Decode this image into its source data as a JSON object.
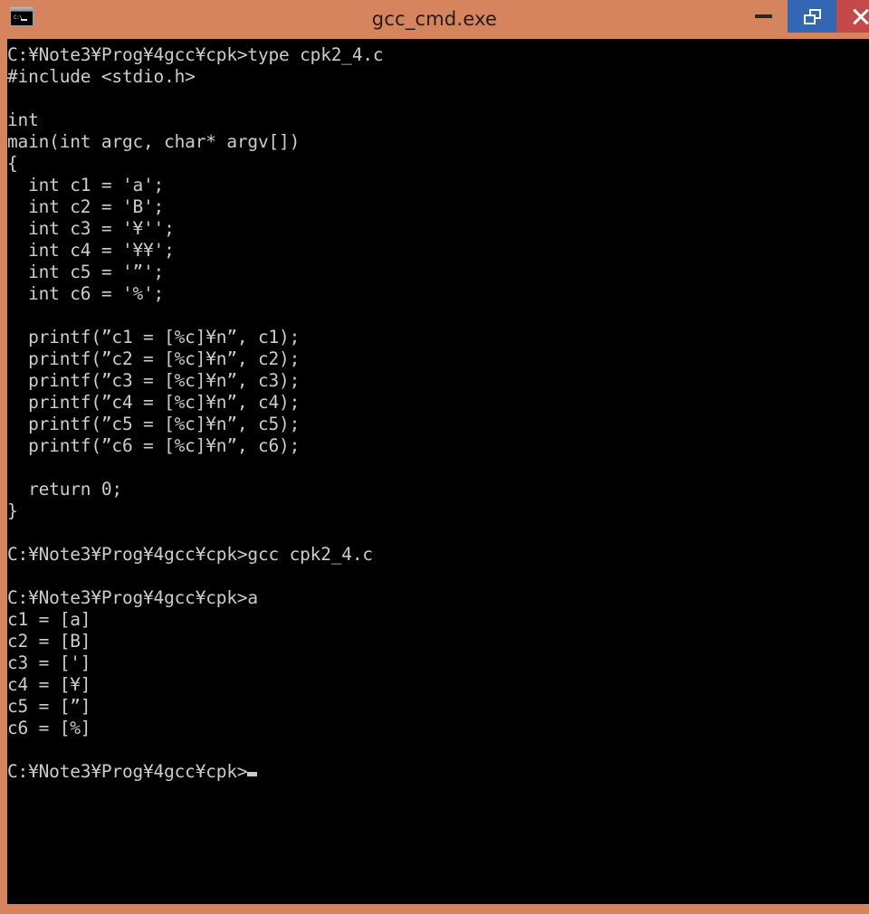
{
  "window": {
    "title": "gcc_cmd.exe",
    "icon": "console-window-icon",
    "icon_prompt_text": "C:\\",
    "frame_color": "#d6845d",
    "console_bg": "#000000",
    "console_fg": "#cccccc"
  },
  "caption_buttons": {
    "minimize": {
      "label": "Minimize",
      "icon": "minimize-icon"
    },
    "restore": {
      "label": "Restore",
      "icon": "restore-icon",
      "highlight_color": "#3267b5"
    },
    "close": {
      "label": "Close",
      "icon": "close-icon",
      "color": "#c44a4a"
    }
  },
  "console": {
    "prompt": "C:¥Note3¥Prog¥4gcc¥cpk>",
    "cursor": "block",
    "lines": [
      "C:¥Note3¥Prog¥4gcc¥cpk>type cpk2_4.c",
      "#include <stdio.h>",
      "",
      "int",
      "main(int argc, char* argv[])",
      "{",
      "  int c1 = 'a';",
      "  int c2 = 'B';",
      "  int c3 = '¥'';",
      "  int c4 = '¥¥';",
      "  int c5 = '”';",
      "  int c6 = '%';",
      "",
      "  printf(”c1 = [%c]¥n”, c1);",
      "  printf(”c2 = [%c]¥n”, c2);",
      "  printf(”c3 = [%c]¥n”, c3);",
      "  printf(”c4 = [%c]¥n”, c4);",
      "  printf(”c5 = [%c]¥n”, c5);",
      "  printf(”c6 = [%c]¥n”, c6);",
      "",
      "  return 0;",
      "}",
      "",
      "C:¥Note3¥Prog¥4gcc¥cpk>gcc cpk2_4.c",
      "",
      "C:¥Note3¥Prog¥4gcc¥cpk>a",
      "c1 = [a]",
      "c2 = [B]",
      "c3 = [']",
      "c4 = [¥]",
      "c5 = [”]",
      "c6 = [%]",
      ""
    ],
    "last_prompt_line": "C:¥Note3¥Prog¥4gcc¥cpk>"
  }
}
